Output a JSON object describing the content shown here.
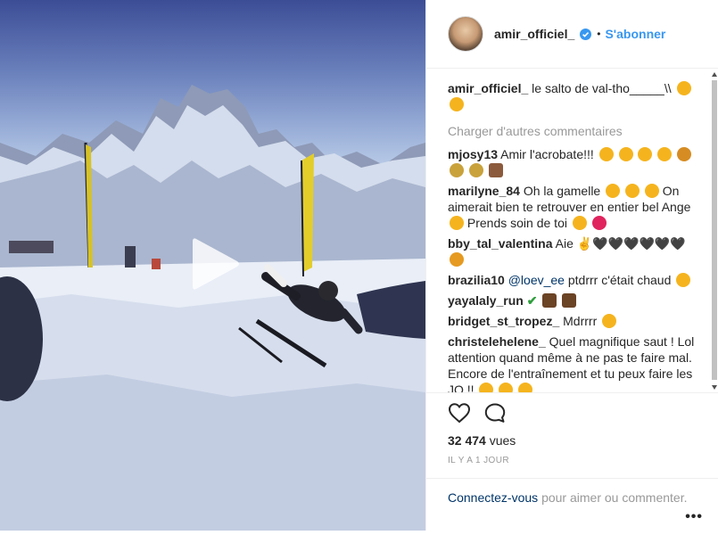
{
  "post": {
    "username": "amir_officiel_",
    "follow_label": "S'abonner",
    "dot": "•"
  },
  "caption": {
    "author": "amir_officiel_",
    "text": "le salto de val-tho_____\\\\"
  },
  "load_more": "Charger d'autres commentaires",
  "comments": [
    {
      "author": "mjosy13",
      "text": "Amir l'acrobate!!!",
      "emojis": [
        "#f5b41e",
        "#f5b41e",
        "#f5b41e",
        "#f5b41e",
        "#d68c22",
        "#c9a23c"
      ]
    },
    {
      "author": "marilyne_84",
      "text": "Oh la gamelle",
      "text2": "On aimerait bien te retrouver en entier bel Ange",
      "text3": "Prends soin de toi"
    },
    {
      "author": "bby_tal_valentina",
      "text": "Aie ✌🖤🖤🖤🖤🖤🖤"
    },
    {
      "author": "brazilia10",
      "mention": "@loev_ee",
      "text": "ptdrrr c'était chaud"
    },
    {
      "author": "yayalaly_run",
      "text": "✔"
    },
    {
      "author": "bridget_st_tropez_",
      "text": "Mdrrrr"
    },
    {
      "author": "christelehelene_",
      "text": "Quel magnifique saut ! Lol attention quand même à ne pas te faire mal. Encore de l'entraînement et tu peux faire les JO !!"
    }
  ],
  "views": {
    "count": "32 474",
    "label": "vues"
  },
  "time_ago": "IL Y A 1 JOUR",
  "login": {
    "link": "Connectez-vous",
    "rest": "pour aimer ou commenter."
  },
  "more": "•••",
  "icons": {
    "like": "heart-icon",
    "comment": "comment-bubble-icon",
    "play": "play-icon",
    "verified": "verified-badge-icon",
    "more": "more-options-icon"
  },
  "colors": {
    "link": "#3897f0",
    "muted": "#999999",
    "text": "#262626",
    "verified": "#3897f0"
  }
}
